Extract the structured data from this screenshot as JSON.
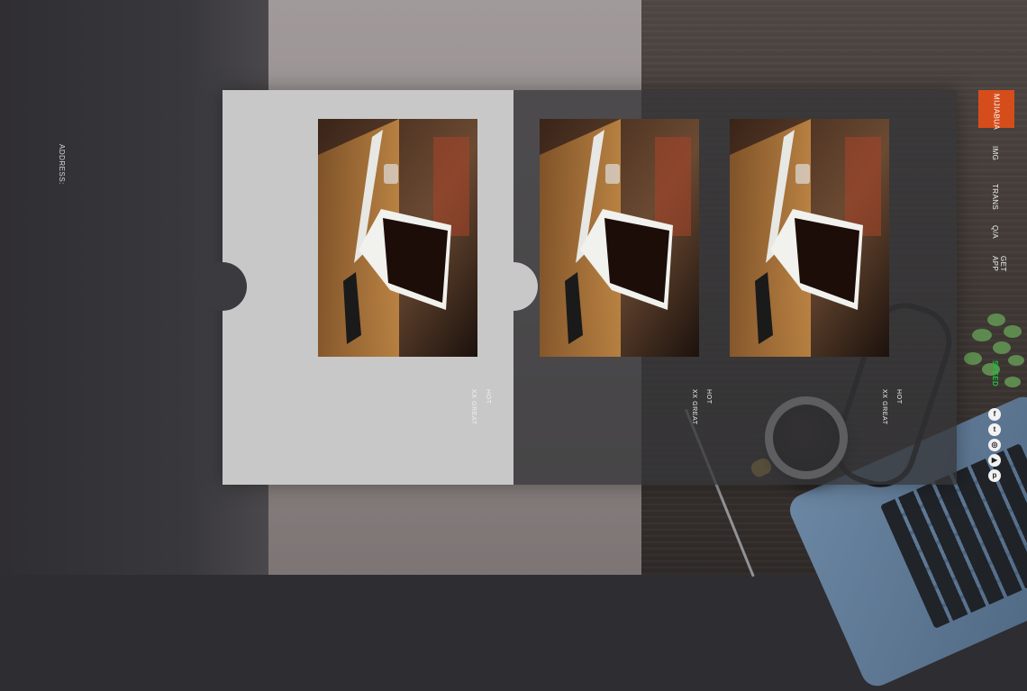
{
  "sidebar": {
    "address_label": "ADDRESS:"
  },
  "nav": {
    "items": [
      {
        "label": "MIJIABUA",
        "active": true
      },
      {
        "label": "IMG"
      },
      {
        "label": "TRANS"
      },
      {
        "label": "Q/A"
      },
      {
        "label": "GET APP"
      }
    ],
    "speed_label": "SPEED",
    "accent_color": "#d64d1c",
    "speed_color": "#1fbf3e"
  },
  "social": [
    {
      "icon": "facebook-icon",
      "glyph": "f"
    },
    {
      "icon": "twitter-icon",
      "glyph": "t"
    },
    {
      "icon": "instagram-icon",
      "glyph": "◎"
    },
    {
      "icon": "youtube-icon",
      "glyph": "▶"
    },
    {
      "icon": "pinterest-icon",
      "glyph": "p"
    }
  ],
  "cards": [
    {
      "title": "HOT",
      "subtitle": "XX  GREAT"
    },
    {
      "title": "HOT",
      "subtitle": "XX  GREAT"
    },
    {
      "title": "HOT",
      "subtitle": "XX  GREAT"
    }
  ]
}
